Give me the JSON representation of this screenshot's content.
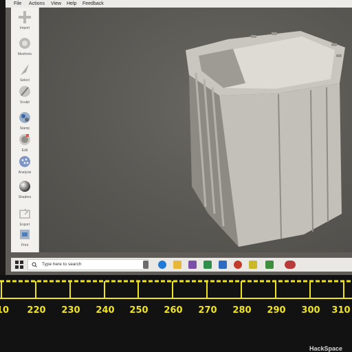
{
  "menubar": {
    "items": [
      "File",
      "Actions",
      "View",
      "Help",
      "Feedback"
    ]
  },
  "tools": [
    {
      "label": "Import",
      "icon": "plus-icon"
    },
    {
      "label": "Meshmix",
      "icon": "meshmix-icon"
    },
    {
      "label": "Select",
      "icon": "select-arrow-icon"
    },
    {
      "label": "Sculpt",
      "icon": "sculpt-brush-icon"
    },
    {
      "label": "Stamp",
      "icon": "stamp-icon"
    },
    {
      "label": "Edit",
      "icon": "edit-icon"
    },
    {
      "label": "Analysis",
      "icon": "analysis-icon"
    },
    {
      "label": "Shaders",
      "icon": "shaders-sphere-icon"
    },
    {
      "label": "Export",
      "icon": "export-icon"
    },
    {
      "label": "Print",
      "icon": "print-icon"
    }
  ],
  "taskbar": {
    "search_placeholder": "Type here to search",
    "icons": [
      "task-view-icon",
      "edge-icon",
      "file-explorer-icon",
      "store-icon",
      "chrome-icon",
      "photos-icon",
      "app-icon",
      "notes-icon",
      "paint-icon",
      "meshmixer-icon"
    ]
  },
  "ruler": {
    "labels": [
      "10",
      "220",
      "230",
      "240",
      "250",
      "260",
      "270",
      "280",
      "290",
      "300",
      "310"
    ]
  },
  "watermark": "HackSpace",
  "colors": {
    "ruler_accent": "#f0e41f",
    "viewport_bg": "#5f5c57",
    "model": "#d3d0c9"
  }
}
